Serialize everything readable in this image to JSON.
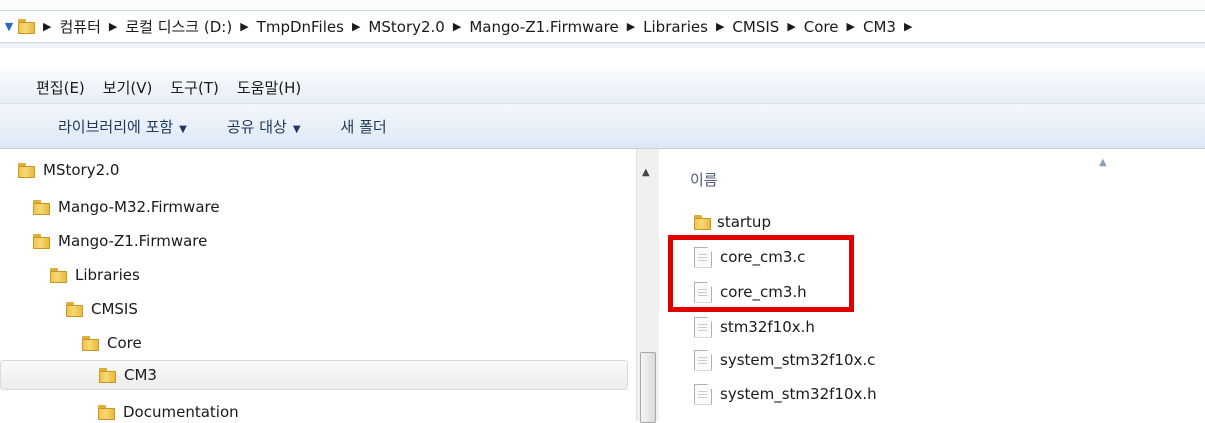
{
  "address_bar": {
    "breadcrumbs": [
      "컴퓨터",
      "로컬 디스크 (D:)",
      "TmpDnFiles",
      "MStory2.0",
      "Mango-Z1.Firmware",
      "Libraries",
      "CMSIS",
      "Core",
      "CM3"
    ]
  },
  "menu_bar": {
    "items": [
      "편집(E)",
      "보기(V)",
      "도구(T)",
      "도움말(H)"
    ]
  },
  "toolbar": {
    "include_library": "라이브러리에 포함",
    "share_with": "공유 대상",
    "new_folder": "새 폴더"
  },
  "nav_tree": [
    {
      "label": "MStory2.0",
      "icon": "folder-icon"
    },
    {
      "label": "Mango-M32.Firmware",
      "icon": "folder-icon"
    },
    {
      "label": "Mango-Z1.Firmware",
      "icon": "folder-icon"
    },
    {
      "label": "Libraries",
      "icon": "folder-icon"
    },
    {
      "label": "CMSIS",
      "icon": "folder-icon"
    },
    {
      "label": "Core",
      "icon": "folder-icon"
    },
    {
      "label": "CM3",
      "icon": "folder-icon",
      "selected": true
    },
    {
      "label": "Documentation",
      "icon": "folder-icon"
    }
  ],
  "file_list": {
    "column_name": "이름",
    "items": [
      {
        "name": "startup",
        "icon": "folder-icon"
      },
      {
        "name": "core_cm3.c",
        "icon": "document-icon"
      },
      {
        "name": "core_cm3.h",
        "icon": "document-icon"
      },
      {
        "name": "stm32f10x.h",
        "icon": "document-icon"
      },
      {
        "name": "system_stm32f10x.c",
        "icon": "document-icon"
      },
      {
        "name": "system_stm32f10x.h",
        "icon": "document-icon"
      }
    ]
  },
  "colors": {
    "highlight": "#e00000",
    "toolbar_text": "#1e395b"
  }
}
